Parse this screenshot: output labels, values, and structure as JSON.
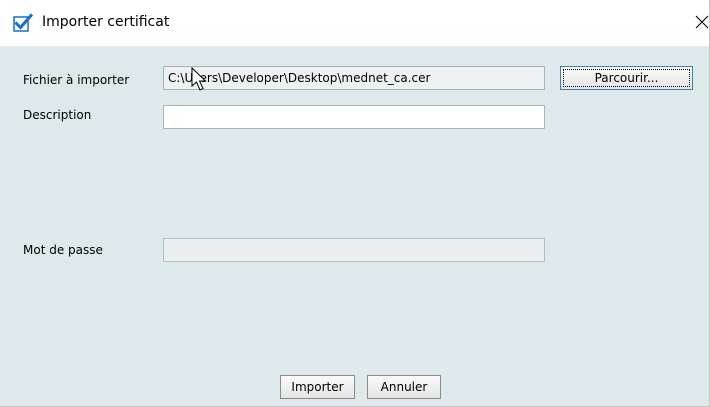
{
  "window": {
    "title": "Importer certificat"
  },
  "form": {
    "file_label": "Fichier à importer",
    "file_value": "C:\\Users\\Developer\\Desktop\\mednet_ca.cer",
    "browse_label": "Parcourir...",
    "description_label": "Description",
    "description_value": "",
    "password_label": "Mot de passe",
    "password_value": ""
  },
  "actions": {
    "import_label": "Importer",
    "cancel_label": "Annuler"
  },
  "icons": {
    "title": "checkbox-checked-icon",
    "close": "close-icon",
    "cursor": "mouse-pointer-icon"
  },
  "colors": {
    "content_bg": "#dde9ea",
    "accent": "#1a6fc4"
  }
}
